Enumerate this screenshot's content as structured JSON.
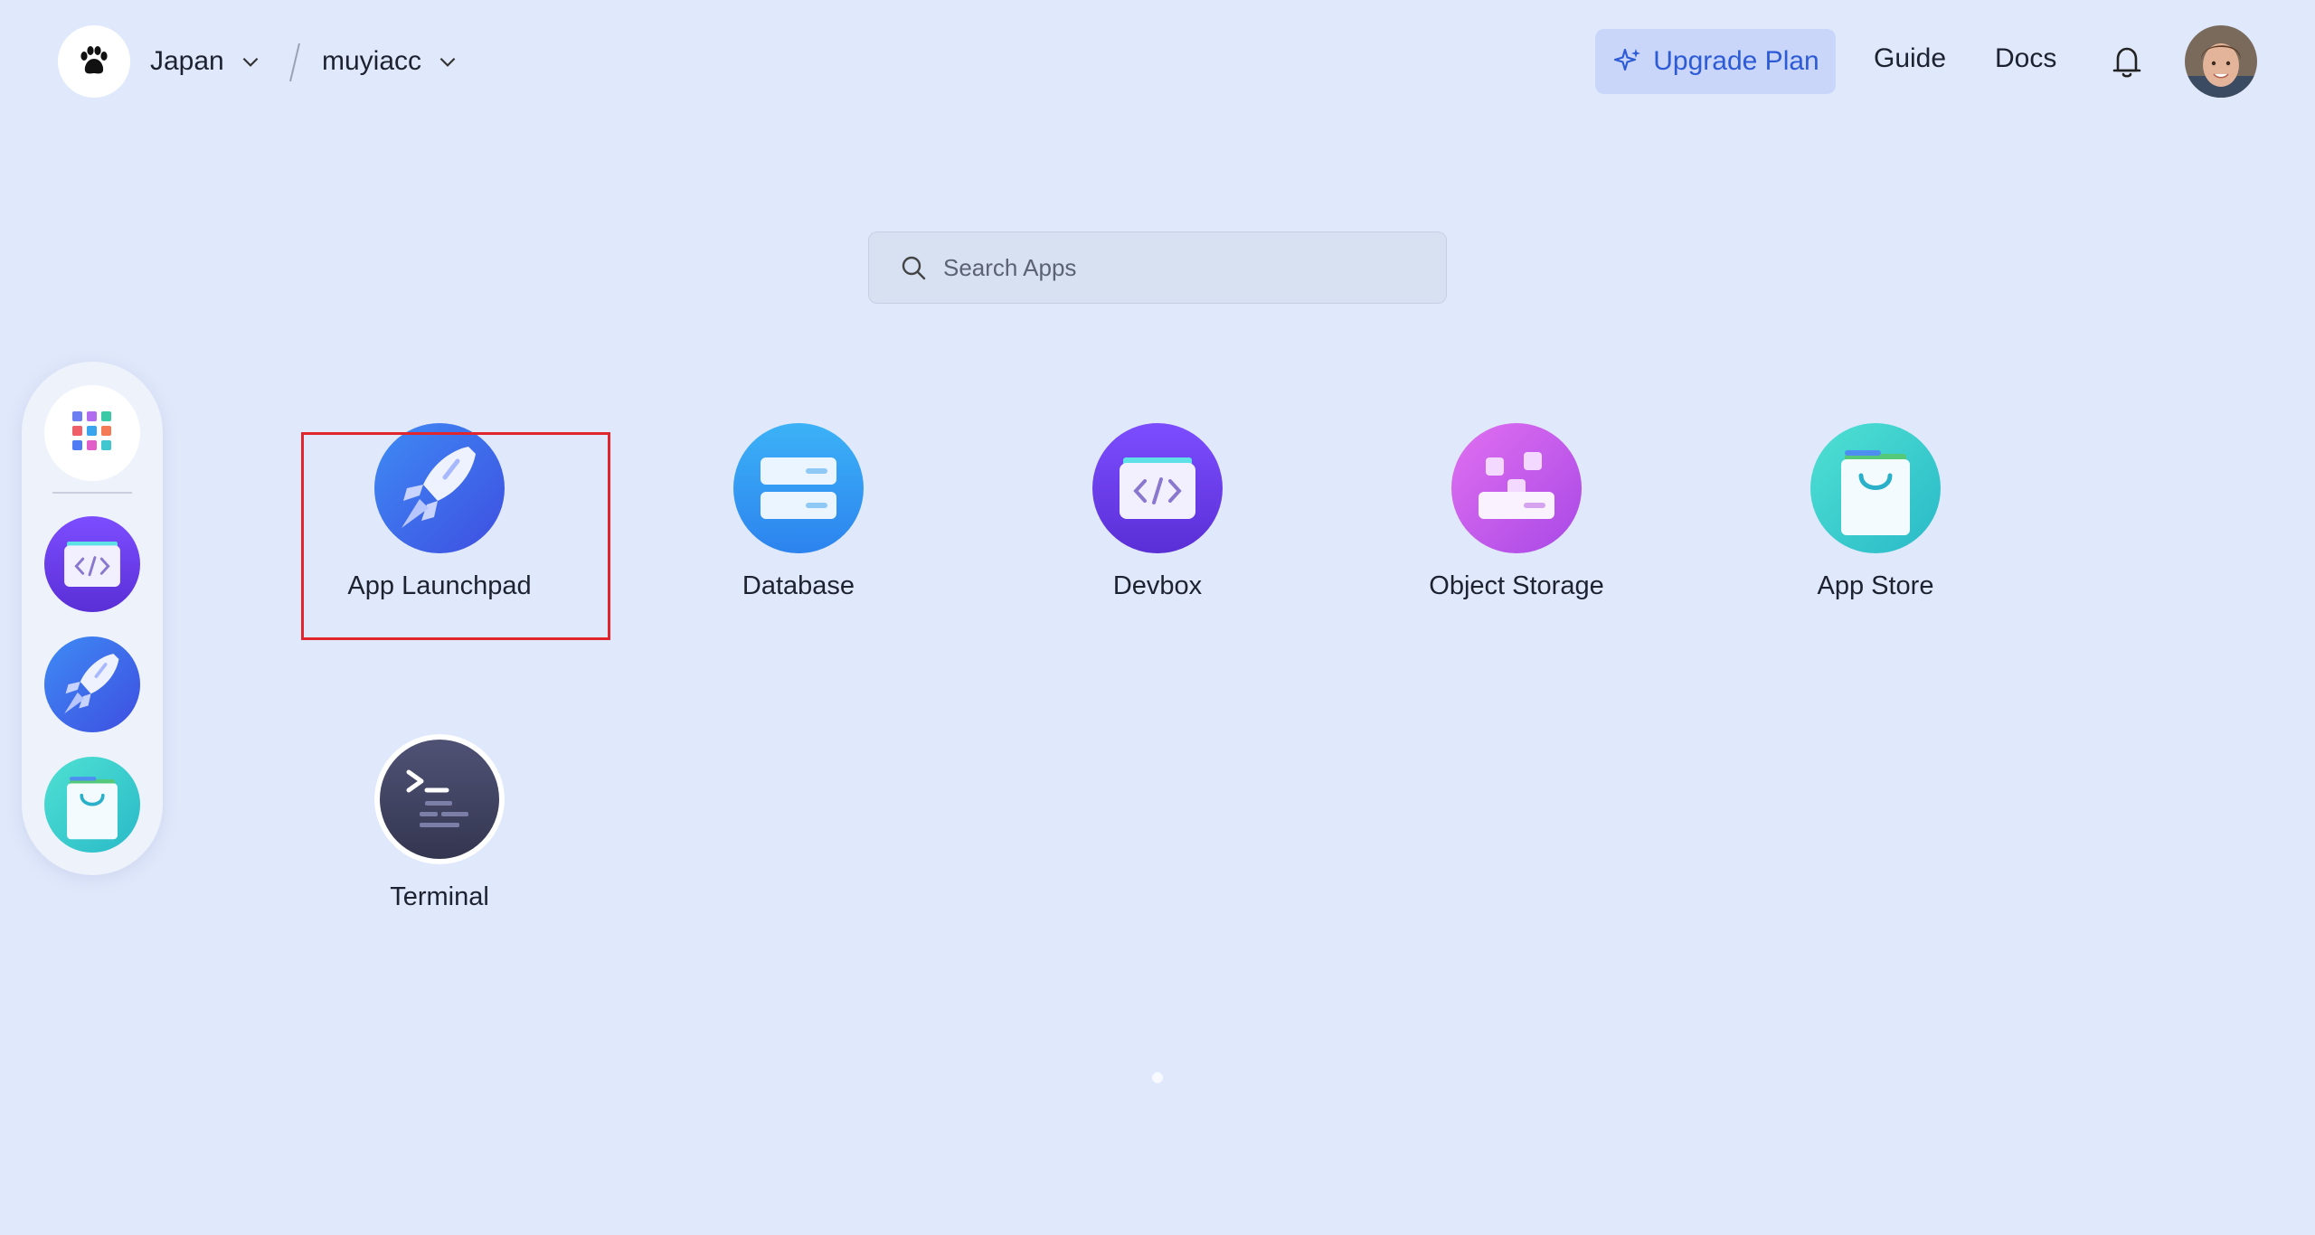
{
  "header": {
    "region": "Japan",
    "workspace": "muyiacc",
    "upgrade_label": "Upgrade Plan",
    "guide_label": "Guide",
    "docs_label": "Docs"
  },
  "search": {
    "placeholder": "Search Apps"
  },
  "dock": {
    "items": [
      {
        "name": "all-apps",
        "icon": "grid-icon"
      },
      {
        "name": "devbox",
        "icon": "code-icon"
      },
      {
        "name": "app-launchpad",
        "icon": "rocket-icon"
      },
      {
        "name": "app-store",
        "icon": "shopping-bag-icon"
      }
    ]
  },
  "apps": [
    {
      "label": "App Launchpad",
      "icon": "rocket-icon"
    },
    {
      "label": "Database",
      "icon": "database-icon"
    },
    {
      "label": "Devbox",
      "icon": "code-icon"
    },
    {
      "label": "Object Storage",
      "icon": "storage-icon"
    },
    {
      "label": "App Store",
      "icon": "shopping-bag-icon"
    },
    {
      "label": "Terminal",
      "icon": "terminal-icon"
    }
  ],
  "colors": {
    "background": "#e0e8fb",
    "accent": "#2d5bd6",
    "highlight": "#e0252c"
  }
}
